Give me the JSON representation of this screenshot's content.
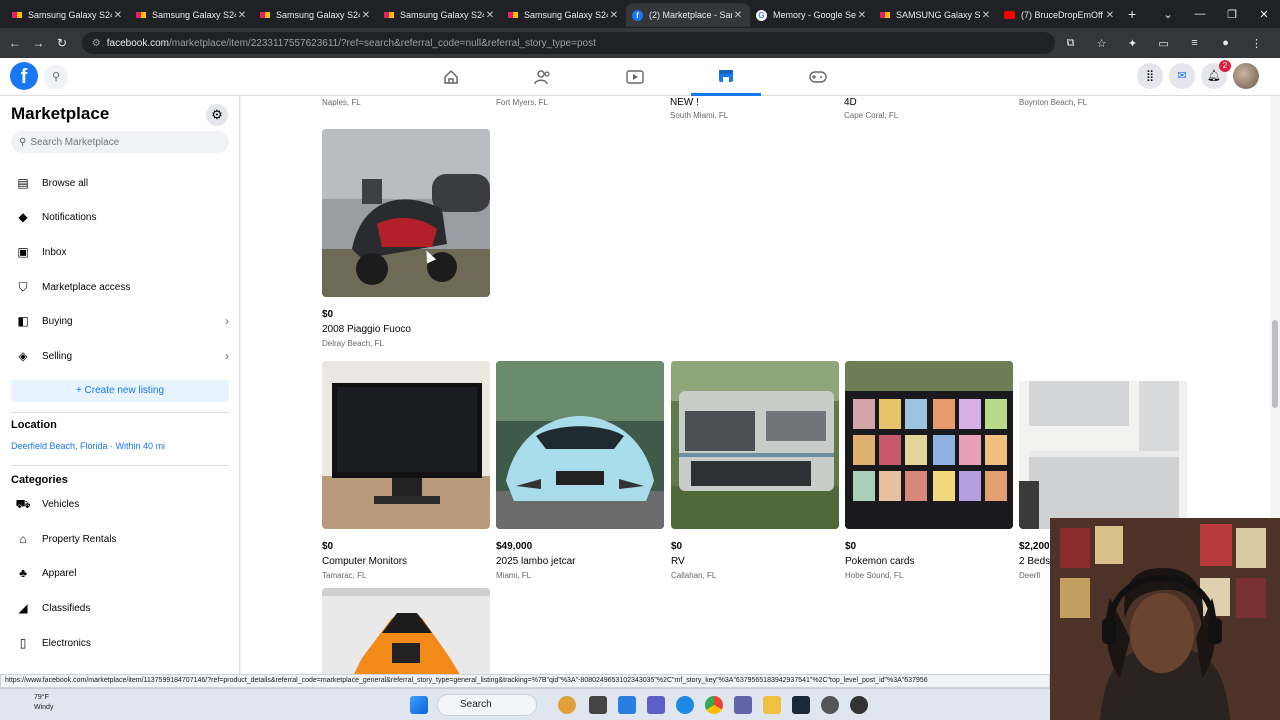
{
  "browser": {
    "tabs": [
      {
        "title": "Samsung Galaxy S24",
        "icon": "samsung-favicon"
      },
      {
        "title": "Samsung Galaxy S24",
        "icon": "samsung-favicon"
      },
      {
        "title": "Samsung Galaxy S24-",
        "icon": "samsung-favicon"
      },
      {
        "title": "Samsung Galaxy S24",
        "icon": "samsung-favicon"
      },
      {
        "title": "Samsung Galaxy S24",
        "icon": "samsung-favicon"
      },
      {
        "title": "(2) Marketplace - Sam",
        "icon": "facebook-favicon",
        "active": true
      },
      {
        "title": "Memory - Google Sea",
        "icon": "google-favicon"
      },
      {
        "title": "SAMSUNG Galaxy S2",
        "icon": "samsung-favicon"
      },
      {
        "title": "(7) BruceDropEmOff",
        "icon": "youtube-favicon"
      }
    ],
    "url_domain": "facebook.com",
    "url_path": "/marketplace/item/2233117557623611/?ref=search&referral_code=null&referral_story_type=post",
    "status_url": "https://www.facebook.com/marketplace/item/1137599184707146/?ref=product_details&referral_code=marketplace_general&referral_story_type=general_listing&tracking=%7B\"qid\"%3A\"-8080249653102343035\"%2C\"mf_story_key\"%3A\"6379565183942937541\"%2C\"top_level_post_id\"%3A\"637956"
  },
  "facebook": {
    "notification_count": "2",
    "nav_icons": [
      "home-icon",
      "friends-icon",
      "watch-icon",
      "marketplace-icon",
      "gaming-icon"
    ]
  },
  "sidebar": {
    "title": "Marketplace",
    "search_placeholder": "Search Marketplace",
    "items": [
      {
        "label": "Browse all",
        "icon": "storefront-icon"
      },
      {
        "label": "Notifications",
        "icon": "bell-icon"
      },
      {
        "label": "Inbox",
        "icon": "inbox-icon"
      },
      {
        "label": "Marketplace access",
        "icon": "shield-icon"
      },
      {
        "label": "Buying",
        "icon": "shopping-bag-icon"
      },
      {
        "label": "Selling",
        "icon": "tag-icon"
      }
    ],
    "create_label": "+ Create new listing",
    "location_heading": "Location",
    "location_value": "Deerfield Beach, Florida · Within 40 mi",
    "categories_heading": "Categories",
    "categories": [
      {
        "label": "Vehicles",
        "icon": "car-icon"
      },
      {
        "label": "Property Rentals",
        "icon": "house-icon"
      },
      {
        "label": "Apparel",
        "icon": "shirt-icon"
      },
      {
        "label": "Classifieds",
        "icon": "megaphone-icon"
      },
      {
        "label": "Electronics",
        "icon": "phone-icon"
      }
    ]
  },
  "listings_top_row": [
    {
      "title": "",
      "location": "Naples, FL"
    },
    {
      "title": "",
      "location": "Fort Myers, FL"
    },
    {
      "title": "NEW !",
      "location": "South Miami, FL"
    },
    {
      "title": "4D",
      "location": "Cape Coral, FL"
    },
    {
      "title": "",
      "location": "Boynton Beach, FL"
    }
  ],
  "listings": [
    {
      "price": "$0",
      "title": "2008 Piaggio Fuoco",
      "location": "Delray Beach, FL"
    },
    {
      "price": "$0",
      "title": "Computer Monitors",
      "location": "Tamarac, FL"
    },
    {
      "price": "$49,000",
      "title": "2025 lambo jetcar",
      "location": "Miami, FL"
    },
    {
      "price": "$0",
      "title": "RV",
      "location": "Callahan, FL"
    },
    {
      "price": "$0",
      "title": "Pokemon cards",
      "location": "Hobe Sound, FL"
    },
    {
      "price": "$2,200",
      "title": "2 Beds",
      "location": "Deerfi"
    }
  ],
  "taskbar": {
    "temperature": "79°F",
    "condition": "Windy",
    "search_label": "Search"
  }
}
